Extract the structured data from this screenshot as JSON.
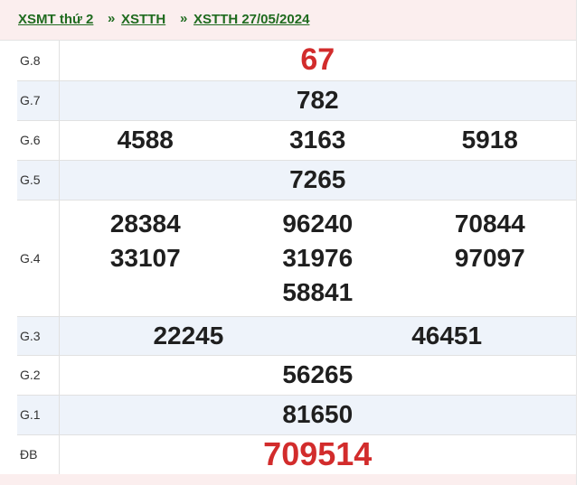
{
  "breadcrumb": {
    "items": [
      "XSMT thứ 2",
      "XSTTH",
      "XSTTH 27/05/2024"
    ],
    "separator": "»"
  },
  "results": {
    "rows": [
      {
        "label": "G.8",
        "numbers": [
          "67"
        ]
      },
      {
        "label": "G.7",
        "numbers": [
          "782"
        ]
      },
      {
        "label": "G.6",
        "numbers": [
          "4588",
          "3163",
          "5918"
        ]
      },
      {
        "label": "G.5",
        "numbers": [
          "7265"
        ]
      },
      {
        "label": "G.4",
        "numbers": [
          "28384",
          "96240",
          "70844",
          "33107",
          "31976",
          "97097",
          "58841"
        ]
      },
      {
        "label": "G.3",
        "numbers": [
          "22245",
          "46451"
        ]
      },
      {
        "label": "G.2",
        "numbers": [
          "56265"
        ]
      },
      {
        "label": "G.1",
        "numbers": [
          "81650"
        ]
      },
      {
        "label": "ĐB",
        "numbers": [
          "709514"
        ]
      }
    ]
  },
  "colors": {
    "highlight": "#d22c2c",
    "link": "#1f6b1f",
    "row_alt": "#eef3fa",
    "header_bg": "#fbeeee"
  }
}
